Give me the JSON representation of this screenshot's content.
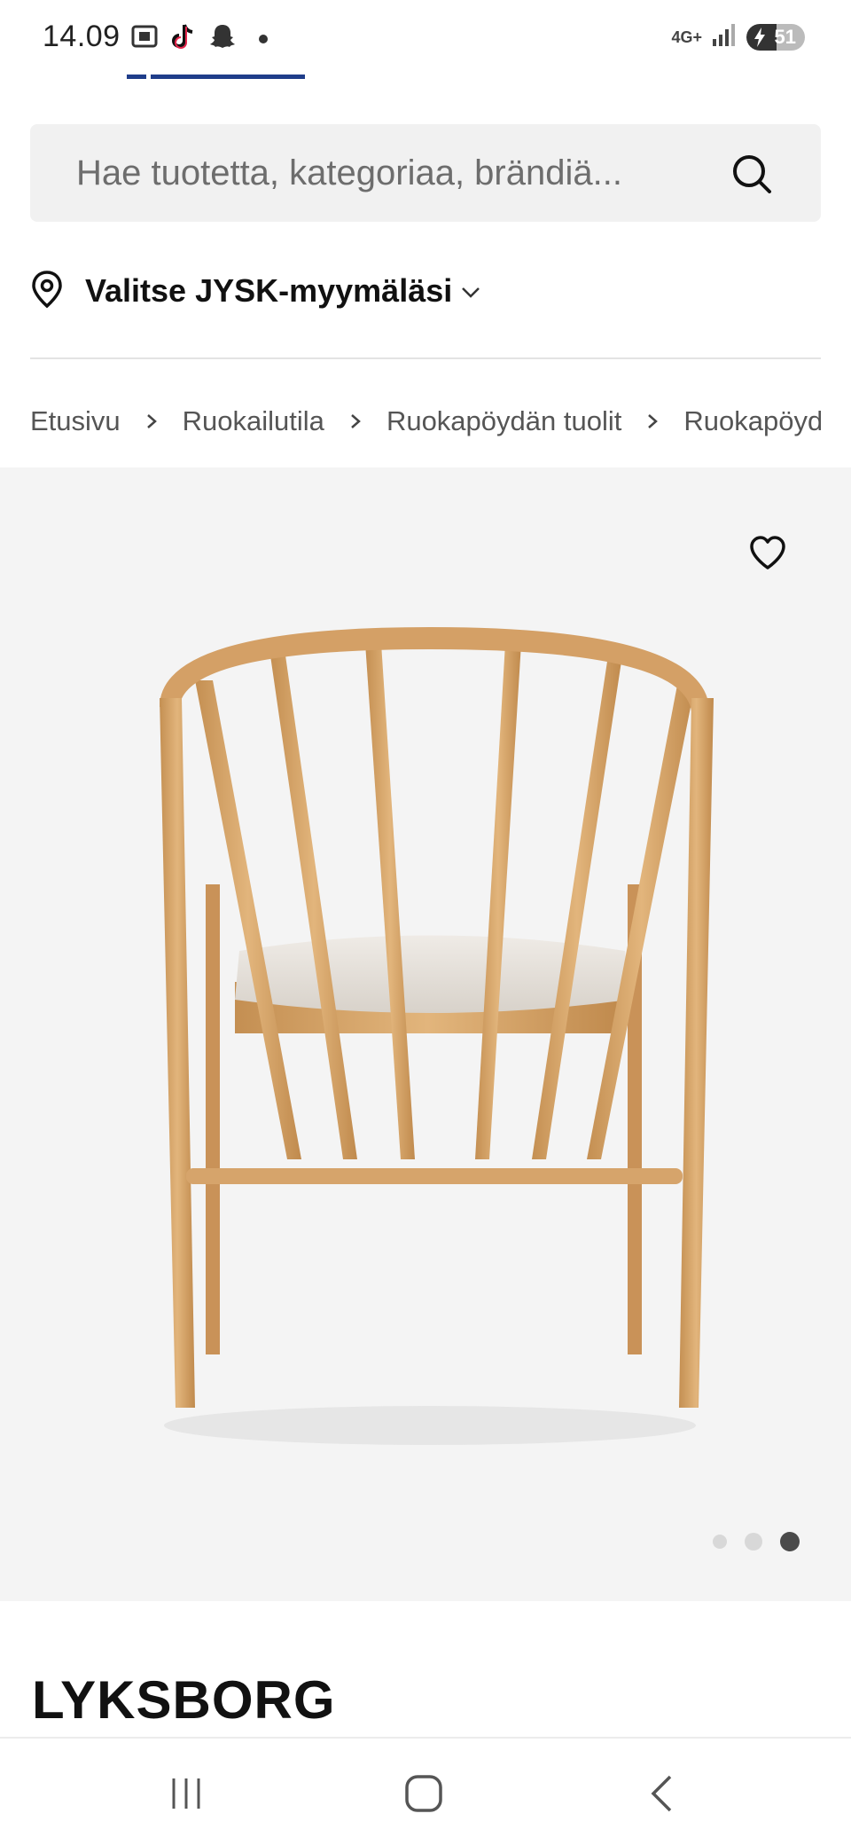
{
  "status_bar": {
    "time": "14.09",
    "network": "4G+",
    "battery": "51",
    "battery_level_percent": 51,
    "icons": [
      "screenshot-icon",
      "tiktok-icon",
      "snapchat-icon",
      "dot-icon",
      "signal-icon",
      "battery-icon"
    ]
  },
  "search": {
    "placeholder": "Hae tuotetta, kategoriaa, brändiä..."
  },
  "store": {
    "label": "Valitse JYSK-myymäläsi"
  },
  "breadcrumb": {
    "items": [
      "Etusivu",
      "Ruokailutila",
      "Ruokapöydän tuolit",
      "Ruokapöydä"
    ]
  },
  "gallery": {
    "image_count": 3,
    "active_index": 3
  },
  "product": {
    "title": "LYKSBORG"
  },
  "colors": {
    "accent": "#1f3d8a",
    "background_gray": "#f4f4f4",
    "wood": "#d7a86e"
  }
}
